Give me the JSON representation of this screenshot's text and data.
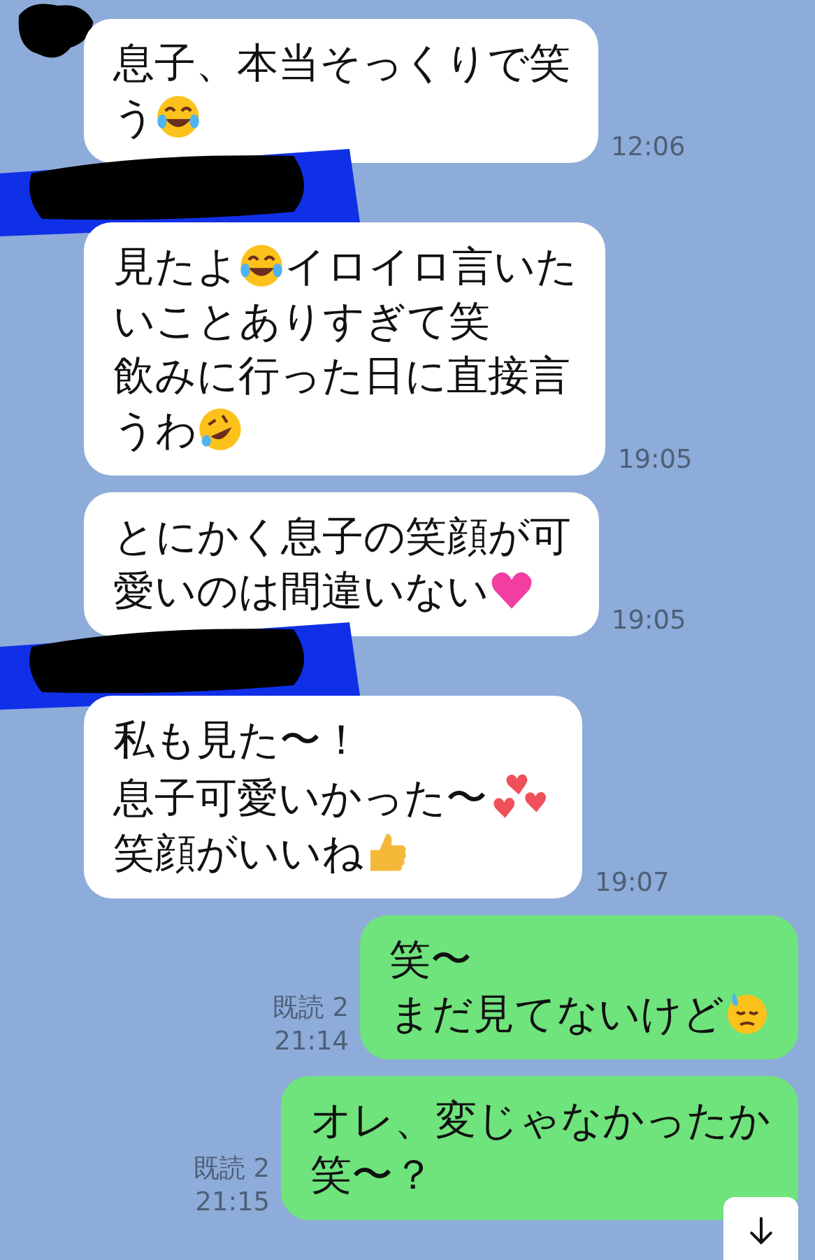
{
  "messages": [
    {
      "kind": "received",
      "sender_hidden": true,
      "time": "12:06",
      "lines": [
        [
          {
            "kind": "text",
            "text": "息子、本当そっくりで笑"
          }
        ],
        [
          {
            "kind": "text",
            "text": "う"
          },
          {
            "kind": "joy"
          }
        ]
      ]
    },
    {
      "kind": "received",
      "sender_hidden": true,
      "time": "19:05",
      "lines": [
        [
          {
            "kind": "text",
            "text": "見たよ"
          },
          {
            "kind": "joy"
          },
          {
            "kind": "text",
            "text": "イロイロ言いた"
          }
        ],
        [
          {
            "kind": "text",
            "text": "いことありすぎて笑"
          }
        ],
        [
          {
            "kind": "text",
            "text": "飲みに行った日に直接言"
          }
        ],
        [
          {
            "kind": "text",
            "text": "うわ"
          },
          {
            "kind": "rofl"
          }
        ]
      ]
    },
    {
      "kind": "received",
      "sender_hidden": false,
      "time": "19:05",
      "lines": [
        [
          {
            "kind": "text",
            "text": "とにかく息子の笑顔が可"
          }
        ],
        [
          {
            "kind": "text",
            "text": "愛いのは間違いない"
          },
          {
            "kind": "heart"
          }
        ]
      ]
    },
    {
      "kind": "received",
      "sender_hidden": true,
      "time": "19:07",
      "lines": [
        [
          {
            "kind": "text",
            "text": "私も見た〜！"
          }
        ],
        [
          {
            "kind": "text",
            "text": "息子可愛いかった〜"
          },
          {
            "kind": "hearts"
          }
        ],
        [
          {
            "kind": "text",
            "text": "笑顔がいいね"
          },
          {
            "kind": "thumbs"
          }
        ]
      ]
    },
    {
      "kind": "sent",
      "read": "既読 2",
      "time": "21:14",
      "lines": [
        [
          {
            "kind": "text",
            "text": "笑〜"
          }
        ],
        [
          {
            "kind": "text",
            "text": "まだ見てないけど"
          },
          {
            "kind": "sweat"
          }
        ]
      ]
    },
    {
      "kind": "sent",
      "read": "既読 2",
      "time": "21:15",
      "lines": [
        [
          {
            "kind": "text",
            "text": "オレ、変じゃなかったか"
          }
        ],
        [
          {
            "kind": "text",
            "text": "笑〜？"
          }
        ]
      ]
    }
  ]
}
